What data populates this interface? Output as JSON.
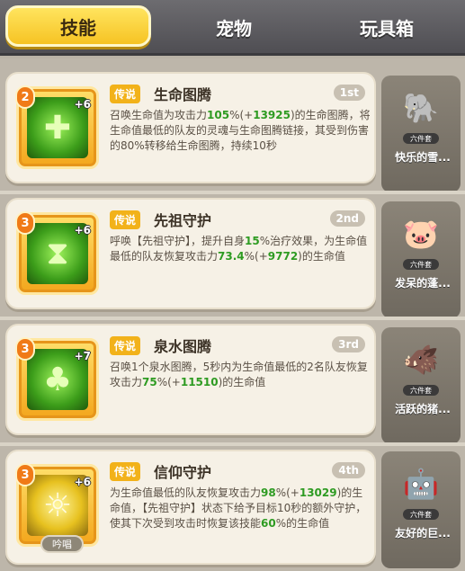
{
  "tabs": [
    {
      "label": "技能"
    },
    {
      "label": "宠物"
    },
    {
      "label": "玩具箱"
    }
  ],
  "skills": [
    {
      "level": "2",
      "plus": "+6",
      "tag": "传说",
      "name": "生命图腾",
      "order": "1st",
      "icon": "totem-icon",
      "desc_parts": [
        "召唤生命值为攻击力",
        "105",
        "%(+",
        "13925",
        ")的生命图腾，将生命值最低的队友的灵魂与生命图腾链接，其受到伤害的80%转移给生命图腾，持续10秒"
      ],
      "pet_name": "快乐的雪...",
      "pet_badge": "六件套",
      "pet_icon": "elephant-pet-icon"
    },
    {
      "level": "3",
      "plus": "+6",
      "tag": "传说",
      "name": "先祖守护",
      "order": "2nd",
      "icon": "shield-icon",
      "desc_parts": [
        "呼唤【先祖守护】，提升自身",
        "15",
        "%治疗效果，为生命值最低的队友恢复攻击力",
        "73.4",
        "%(+",
        "9772",
        ")的生命值"
      ],
      "pet_name": "发呆的蓬...",
      "pet_badge": "六件套",
      "pet_icon": "pig-pet-icon"
    },
    {
      "level": "3",
      "plus": "+7",
      "tag": "传说",
      "name": "泉水图腾",
      "order": "3rd",
      "icon": "fountain-icon",
      "desc_parts": [
        "召唤1个泉水图腾，5秒内为生命值最低的2名队友恢复攻击力",
        "75",
        "%(+",
        "11510",
        ")的生命值"
      ],
      "pet_name": "活跃的猪...",
      "pet_badge": "六件套",
      "pet_icon": "boar-pet-icon"
    },
    {
      "level": "3",
      "plus": "+6",
      "tag": "传说",
      "name": "信仰守护",
      "order": "4th",
      "icon": "faith-icon",
      "chant": "吟唱",
      "desc_parts": [
        "为生命值最低的队友恢复攻击力",
        "98",
        "%(+",
        "13029",
        ")的生命值，【先祖守护】状态下给予目标10秒的额外守护，使其下次受到攻击时恢复该技能",
        "60",
        "%的生命值"
      ],
      "pet_name": "友好的巨...",
      "pet_badge": "六件套",
      "pet_icon": "robot-pet-icon"
    }
  ]
}
